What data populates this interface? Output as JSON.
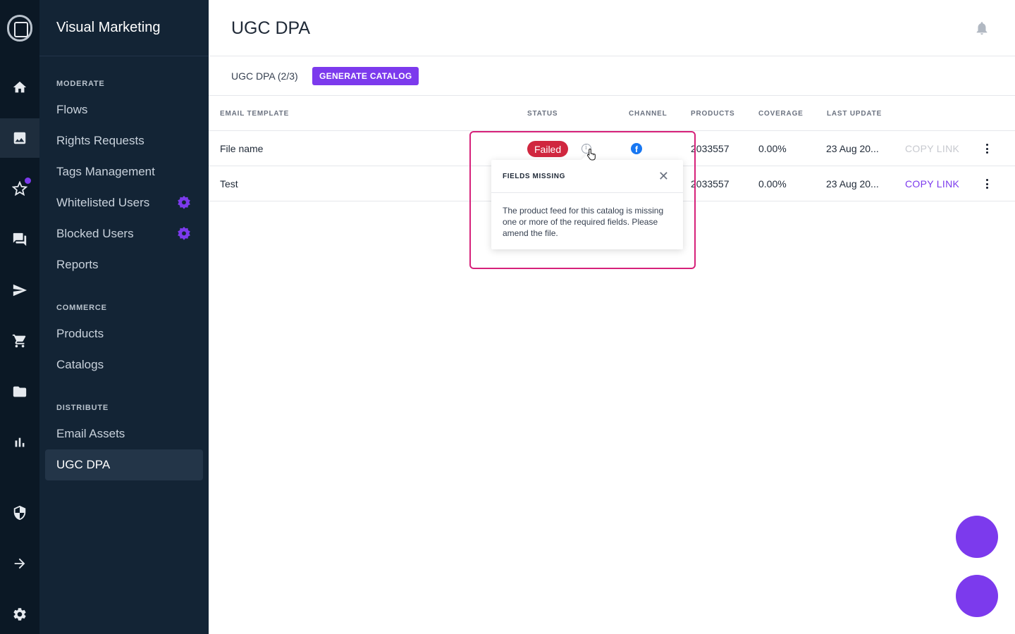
{
  "app": {
    "workspace": "Visual Marketing",
    "accent_color": "#7c3aed",
    "rail_icons": [
      "home-icon",
      "image-icon",
      "star-icon",
      "chat-icon",
      "send-icon",
      "cart-icon",
      "folder-icon",
      "bar-chart-icon",
      "shield-icon",
      "arrow-right-icon",
      "settings-icon"
    ]
  },
  "nav": {
    "sections": [
      {
        "title": "MODERATE"
      },
      {
        "title": "COMMERCE"
      },
      {
        "title": "DISTRIBUTE"
      }
    ],
    "items": [
      {
        "label": "Flows"
      },
      {
        "label": "Rights Requests"
      },
      {
        "label": "Tags Management"
      },
      {
        "label": "Whitelisted Users"
      },
      {
        "label": "Blocked Users"
      },
      {
        "label": "Reports"
      },
      {
        "label": "Products"
      },
      {
        "label": "Catalogs"
      },
      {
        "label": "Email Assets"
      },
      {
        "label": "UGC DPA"
      }
    ]
  },
  "header": {
    "title": "UGC DPA"
  },
  "toolbar": {
    "count_label": "UGC DPA (2/3)",
    "generate_label": "GENERATE CATALOG"
  },
  "table": {
    "columns": [
      "EMAIL TEMPLATE",
      "STATUS",
      "CHANNEL",
      "PRODUCTS",
      "COVERAGE",
      "LAST UPDATE"
    ],
    "rows": [
      {
        "name": "File name",
        "status": "Failed",
        "channel": "f",
        "products": "2033557",
        "coverage": "0.00%",
        "last_update": "23 Aug 20...",
        "action": "COPY LINK"
      },
      {
        "name": "Test",
        "status": "",
        "channel": "",
        "products": "2033557",
        "coverage": "0.00%",
        "last_update": "23 Aug 20...",
        "action": "COPY LINK"
      }
    ]
  },
  "popover": {
    "title": "FIELDS MISSING",
    "close": "✕",
    "body": "The product feed for this catalog is missing one or more of the required fields. Please amend the file."
  }
}
